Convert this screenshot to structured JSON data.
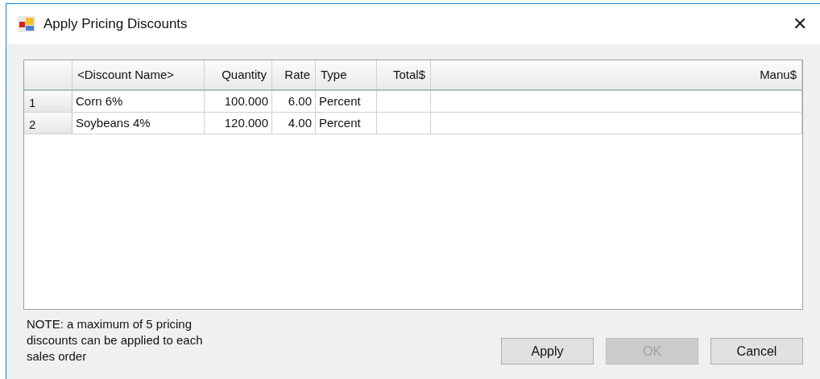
{
  "window": {
    "title": "Apply Pricing Discounts",
    "close": "✕"
  },
  "table": {
    "columns": [
      "<Discount Name>",
      "Quantity",
      "Rate",
      "Type",
      "Total$",
      "Manu$"
    ],
    "rows": [
      {
        "header": "1",
        "cells": [
          "Corn 6%",
          "100.000",
          "6.00",
          "Percent",
          "",
          ""
        ]
      },
      {
        "header": "2",
        "cells": [
          "Soybeans 4%",
          "120.000",
          "4.00",
          "Percent",
          "",
          ""
        ]
      }
    ]
  },
  "note": "NOTE: a maximum of 5 pricing discounts can be applied to each sales order",
  "buttons": [
    {
      "label": "Apply",
      "disabled": false
    },
    {
      "label": "OK",
      "disabled": true
    },
    {
      "label": "Cancel",
      "disabled": false
    }
  ]
}
